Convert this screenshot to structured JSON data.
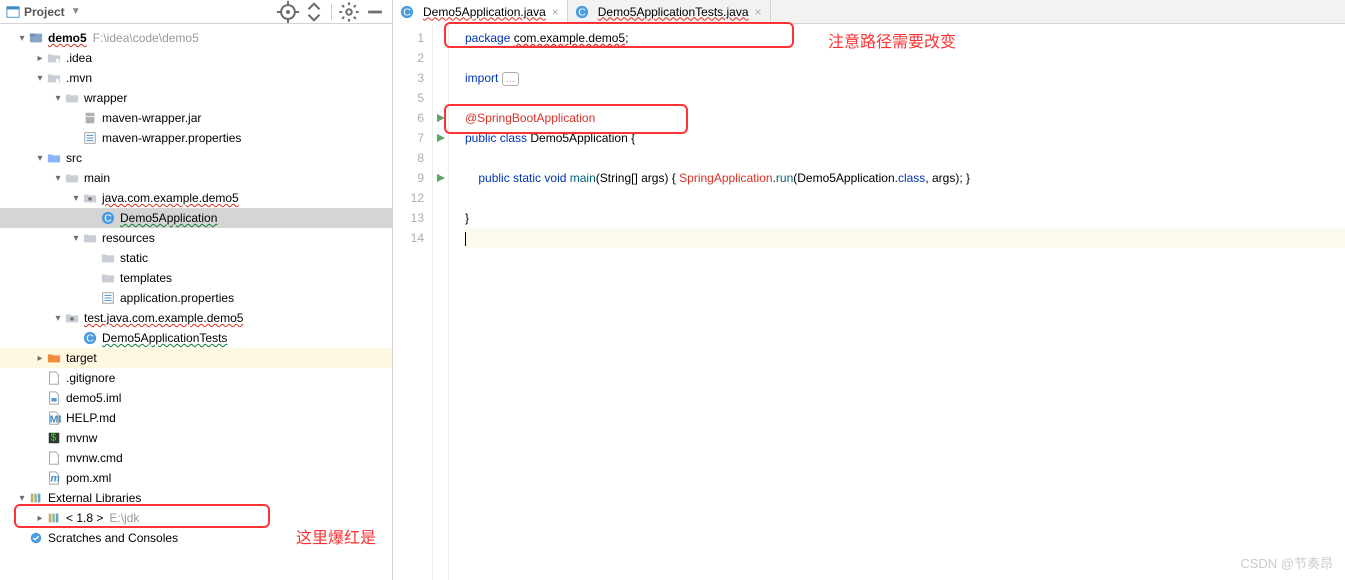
{
  "sidebar": {
    "title": "Project",
    "toolbar_icons": [
      "target-icon",
      "collapse-icon",
      "gear-icon",
      "hide-icon"
    ],
    "nodes": [
      {
        "indent": 0,
        "arrow": "v",
        "icon": "module",
        "label": "demo5",
        "bold": true,
        "extra": "F:\\idea\\code\\demo5",
        "squiggle": true
      },
      {
        "indent": 1,
        "arrow": ">",
        "icon": "folder-dot",
        "label": ".idea"
      },
      {
        "indent": 1,
        "arrow": "v",
        "icon": "folder-dot",
        "label": ".mvn"
      },
      {
        "indent": 2,
        "arrow": "v",
        "icon": "folder",
        "label": "wrapper"
      },
      {
        "indent": 3,
        "arrow": "",
        "icon": "jar",
        "label": "maven-wrapper.jar"
      },
      {
        "indent": 3,
        "arrow": "",
        "icon": "props",
        "label": "maven-wrapper.properties"
      },
      {
        "indent": 1,
        "arrow": "v",
        "icon": "folder-src",
        "label": "src"
      },
      {
        "indent": 2,
        "arrow": "v",
        "icon": "folder",
        "label": "main"
      },
      {
        "indent": 3,
        "arrow": "v",
        "icon": "folder-pkg",
        "label": "java.com.example.demo5",
        "squiggle": true
      },
      {
        "indent": 4,
        "arrow": "",
        "icon": "class",
        "label": "Demo5Application",
        "selected": true,
        "sqgreen": true
      },
      {
        "indent": 3,
        "arrow": "v",
        "icon": "folder",
        "label": "resources"
      },
      {
        "indent": 4,
        "arrow": "",
        "icon": "folder",
        "label": "static"
      },
      {
        "indent": 4,
        "arrow": "",
        "icon": "folder",
        "label": "templates"
      },
      {
        "indent": 4,
        "arrow": "",
        "icon": "props",
        "label": "application.properties"
      },
      {
        "indent": 2,
        "arrow": "v",
        "icon": "folder-pkg",
        "label": "test.java.com.example.demo5",
        "squiggle": true
      },
      {
        "indent": 3,
        "arrow": "",
        "icon": "class",
        "label": "Demo5ApplicationTests",
        "sqgreen": true
      },
      {
        "indent": 1,
        "arrow": ">",
        "icon": "folder-excl",
        "label": "target",
        "hl": true
      },
      {
        "indent": 1,
        "arrow": "",
        "icon": "file",
        "label": ".gitignore"
      },
      {
        "indent": 1,
        "arrow": "",
        "icon": "file-iml",
        "label": "demo5.iml"
      },
      {
        "indent": 1,
        "arrow": "",
        "icon": "file-md",
        "label": "HELP.md"
      },
      {
        "indent": 1,
        "arrow": "",
        "icon": "file-sh",
        "label": "mvnw"
      },
      {
        "indent": 1,
        "arrow": "",
        "icon": "file",
        "label": "mvnw.cmd"
      },
      {
        "indent": 1,
        "arrow": "",
        "icon": "file-m",
        "label": "pom.xml"
      },
      {
        "indent": 0,
        "arrow": "v",
        "icon": "lib",
        "label": "External Libraries"
      },
      {
        "indent": 1,
        "arrow": ">",
        "icon": "lib",
        "label": "< 1.8 >",
        "extra": "E:\\jdk"
      },
      {
        "indent": 0,
        "arrow": "",
        "icon": "scratch",
        "label": "Scratches and Consoles"
      }
    ]
  },
  "tabs": [
    {
      "label": "Demo5Application.java",
      "active": true,
      "squiggle": true
    },
    {
      "label": "Demo5ApplicationTests.java",
      "active": false,
      "squiggle": true
    }
  ],
  "code": {
    "lines": [
      {
        "n": 1,
        "html": "<span class='kw'>package</span> <span class='err'>com.example.demo5</span>;"
      },
      {
        "n": 2,
        "html": ""
      },
      {
        "n": 3,
        "html": "<span class='kw'>import</span> <span class='fold'>...</span>"
      },
      {
        "n": 5,
        "html": ""
      },
      {
        "n": 6,
        "run": true,
        "html": "<span class='ann red-txt'>@SpringBootApplication</span>"
      },
      {
        "n": 7,
        "run": true,
        "html": "<span class='kw'>public class</span> <span class='cls'>Demo5Application</span> {"
      },
      {
        "n": 8,
        "html": ""
      },
      {
        "n": 9,
        "run": true,
        "html": "    <span class='kw'>public static</span> <span class='kw'>void</span> <span class='fn'>main</span>(<span class='cls'>String</span>[] args) { <span class='red-txt'>SpringApplication</span>.<span class='fn'>run</span>(Demo5Application.<span class='kw'>class</span>, args); }"
      },
      {
        "n": 12,
        "html": ""
      },
      {
        "n": 13,
        "html": "}"
      },
      {
        "n": 14,
        "caret": true,
        "html": "<span class='caret-stick'></span>"
      }
    ]
  },
  "annotations": {
    "top_note": "注意路径需要改变",
    "bottom_note": "这里爆红是"
  },
  "watermark": "CSDN @节奏昂"
}
